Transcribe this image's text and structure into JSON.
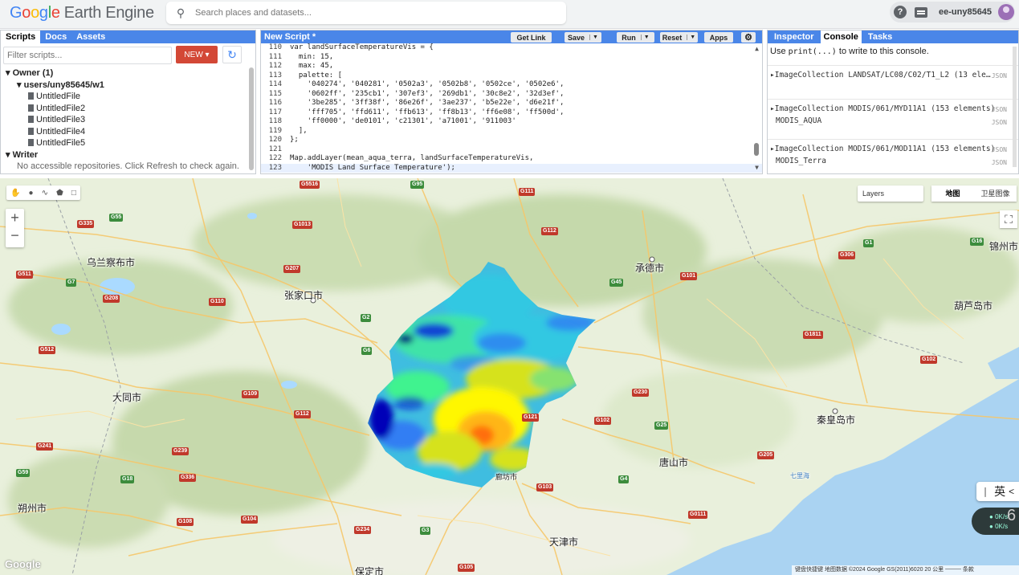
{
  "header": {
    "logo_google": [
      "G",
      "o",
      "o",
      "g",
      "l",
      "e"
    ],
    "logo_product": "Earth Engine",
    "search_placeholder": "Search places and datasets...",
    "help_icon": "?",
    "username": "ee-uny85645"
  },
  "left_panel": {
    "tabs": [
      "Scripts",
      "Docs",
      "Assets"
    ],
    "filter_placeholder": "Filter scripts...",
    "new_button": "NEW",
    "owner_label": "Owner (1)",
    "repo": "users/uny85645/w1",
    "files": [
      "UntitledFile",
      "UntitledFile2",
      "UntitledFile3",
      "UntitledFile4",
      "UntitledFile5"
    ],
    "writer_label": "Writer",
    "writer_msg": "No accessible repositories. Click Refresh to check again."
  },
  "editor": {
    "title": "New Script *",
    "buttons": {
      "get_link": "Get Link",
      "save": "Save",
      "run": "Run",
      "reset": "Reset",
      "apps": "Apps"
    },
    "lines": [
      {
        "n": "110",
        "t": "var landSurfaceTemperatureVis = {"
      },
      {
        "n": "111",
        "t": "  min: 15,"
      },
      {
        "n": "112",
        "t": "  max: 45,"
      },
      {
        "n": "113",
        "t": "  palette: ["
      },
      {
        "n": "114",
        "t": "    '040274', '040281', '0502a3', '0502b8', '0502ce', '0502e6',"
      },
      {
        "n": "115",
        "t": "    '0602ff', '235cb1', '307ef3', '269db1', '30c8e2', '32d3ef',"
      },
      {
        "n": "116",
        "t": "    '3be285', '3ff38f', '86e26f', '3ae237', 'b5e22e', 'd6e21f',"
      },
      {
        "n": "117",
        "t": "    'fff705', 'ffd611', 'ffb613', 'ff8b13', 'ff6e08', 'ff500d',"
      },
      {
        "n": "118",
        "t": "    'ff0000', 'de0101', 'c21301', 'a71001', '911003'"
      },
      {
        "n": "119",
        "t": "  ],"
      },
      {
        "n": "120",
        "t": "};"
      },
      {
        "n": "121",
        "t": ""
      },
      {
        "n": "122",
        "t": "Map.addLayer(mean_aqua_terra, landSurfaceTemperatureVis,"
      },
      {
        "n": "123",
        "t": "    'MODIS Land Surface Temperature');"
      }
    ]
  },
  "right_panel": {
    "tabs": [
      "Inspector",
      "Console",
      "Tasks"
    ],
    "info_prefix": "Use ",
    "info_code": "print(...)",
    "info_suffix": " to write to this console.",
    "entries": [
      {
        "text": "ImageCollection LANDSAT/LC08/C02/T1_L2 (13 ele…",
        "json": "JSON",
        "sub": ""
      },
      {
        "text": "ImageCollection MODIS/061/MYD11A1 (153 elements)",
        "json": "JSON",
        "sub": "MODIS_AQUA"
      },
      {
        "text": "ImageCollection MODIS/061/MOD11A1 (153 elements)",
        "json": "JSON",
        "sub": "MODIS_Terra"
      }
    ]
  },
  "map": {
    "layers_label": "Layers",
    "map_types": [
      "地图",
      "卫星图像"
    ],
    "ime_label": "英",
    "net_up": "0K/s",
    "net_down": "0K/s",
    "net_digit": "6",
    "attribution": "键盘快捷键   地图数据 ©2024 Google GS(2011)6020   20 公里 ────   条款",
    "logo": "Google",
    "cities": [
      {
        "name": "乌兰察布市"
      },
      {
        "name": "张家口市"
      },
      {
        "name": "承德市"
      },
      {
        "name": "锦州市"
      },
      {
        "name": "葫芦岛市"
      },
      {
        "name": "大同市"
      },
      {
        "name": "秦皇岛市"
      },
      {
        "name": "唐山市"
      },
      {
        "name": "朔州市"
      },
      {
        "name": "廊坊市"
      },
      {
        "name": "天津市"
      },
      {
        "name": "保定市"
      },
      {
        "name": "七里海"
      }
    ],
    "shields": [
      "G5516",
      "G95",
      "G111",
      "G55",
      "G335",
      "G1013",
      "G207",
      "G112",
      "G45",
      "G101",
      "G306",
      "G1",
      "G6",
      "G109",
      "G239",
      "G230",
      "G2",
      "G25",
      "G121",
      "G102",
      "G4",
      "G103",
      "G234",
      "G3",
      "G18",
      "G336",
      "G241",
      "G108",
      "G105",
      "G112",
      "G205",
      "G16",
      "G110",
      "G511",
      "G7",
      "G208",
      "G512",
      "G59",
      "G102",
      "G0111",
      "G104",
      "G1811"
    ]
  },
  "colors": {
    "tab_blue": "#4a86e8",
    "new_red": "#d34836",
    "lst_palette": [
      "#040274",
      "#0502e6",
      "#307ef3",
      "#30c8e2",
      "#3ff38f",
      "#86e26f",
      "#d6e21f",
      "#fff705",
      "#ffb613",
      "#ff6e08",
      "#ff0000",
      "#a71001"
    ]
  },
  "icons": [
    "search-icon",
    "help-icon",
    "chat-icon",
    "avatar",
    "refresh-icon",
    "settings-icon",
    "hand-icon",
    "marker-icon",
    "line-icon",
    "polygon-icon",
    "rectangle-icon",
    "zoom-in-icon",
    "zoom-out-icon",
    "fullscreen-icon"
  ]
}
